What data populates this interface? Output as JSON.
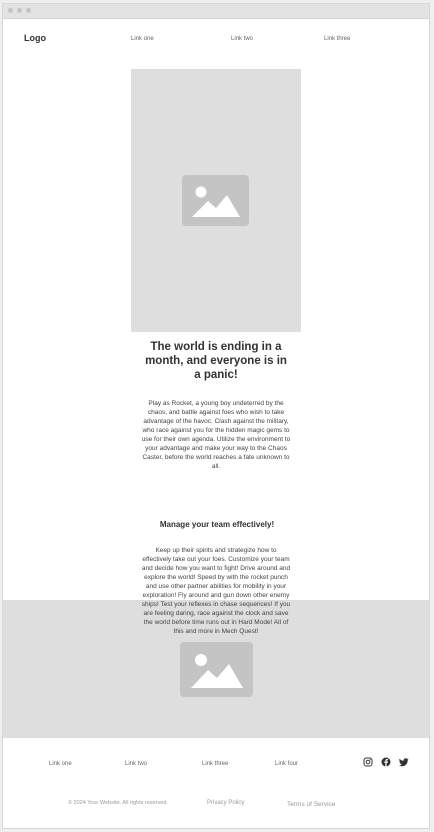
{
  "nav": {
    "logo": "Logo",
    "links": [
      "Link one",
      "Link two",
      "Link three"
    ]
  },
  "hero": {
    "title": "The world is ending in a month, and everyone is in a panic!",
    "body": "Play as Rocket, a young boy undeterred by the chaos, and battle against foes who wish to take advantage of the havoc. Clash against the military, who race against you for the hidden magic gems to use for their own agenda. Utilize the environment to your advantage and make your way to the Chaos Caster, before the world reaches a fate unknown to all."
  },
  "feature": {
    "title": "Manage your team effectively!",
    "body": "Keep up their spirits and strategize how to effectively take out your foes. Customize your team and decide how you want to fight! Drive around and explore the world! Speed by with the rocket punch and use other partner abilities for mobility in your exploration! Fly around and gun down other enemy ships! Test your reflexes in chase sequences! If you are feeling daring, race against the clock and save the world before time runs out in Hard Mode! All of this and more in Mech Quest!"
  },
  "footer": {
    "links": [
      "Link one",
      "Link two",
      "Link three",
      "Link four"
    ],
    "social_icons": [
      "instagram-icon",
      "facebook-icon",
      "twitter-icon"
    ],
    "copyright": "© 2024 Your Website. All rights reserved.",
    "privacy": "Privacy Policy",
    "terms": "Terms of Service"
  },
  "colors": {
    "placeholder_bg": "#dedede",
    "placeholder_icon": "#c4c4c4",
    "text": "#333333"
  }
}
